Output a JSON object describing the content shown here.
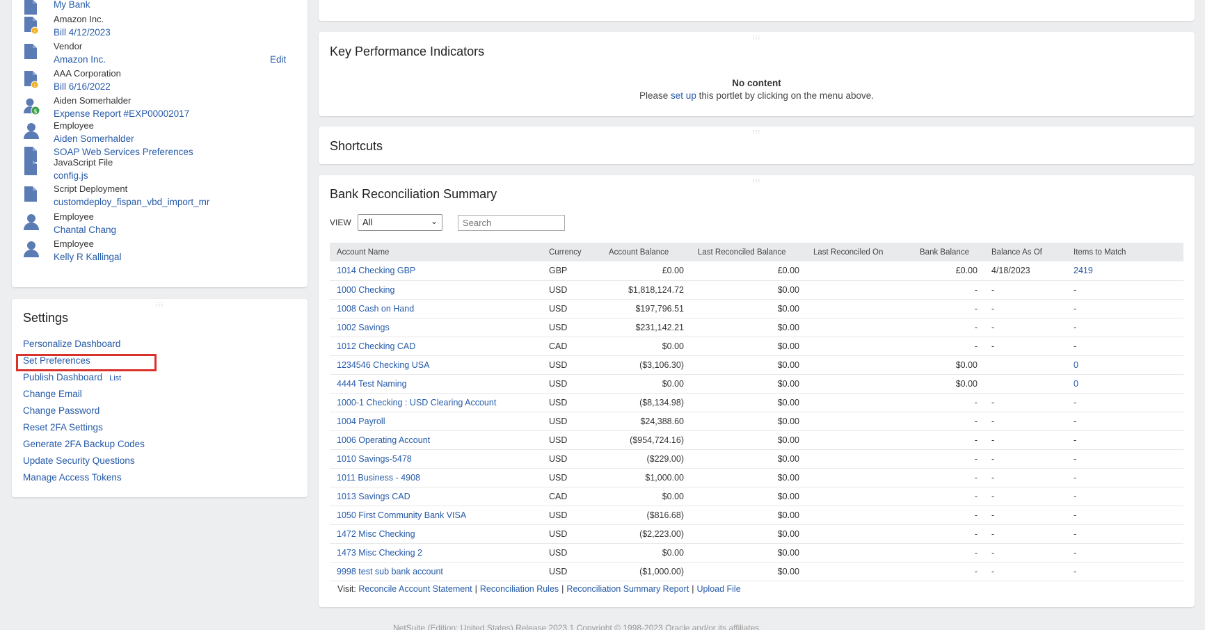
{
  "recent": {
    "items": [
      {
        "type": "",
        "name": "My Bank",
        "icon": "document-icon",
        "edit": ""
      },
      {
        "type": "Amazon Inc.",
        "name": "Bill 4/12/2023",
        "icon": "bill-document-icon",
        "edit": ""
      },
      {
        "type": "Vendor",
        "name": "Amazon Inc.",
        "icon": "document-icon",
        "edit": "Edit"
      },
      {
        "type": "AAA Corporation",
        "name": "Bill 6/16/2022",
        "icon": "bill-document-icon",
        "edit": ""
      },
      {
        "type": "Aiden Somerhalder",
        "name": "Expense Report #EXP00002017",
        "icon": "expense-report-icon",
        "edit": ""
      },
      {
        "type": "Employee",
        "name": "Aiden Somerhalder",
        "icon": "employee-icon",
        "edit": ""
      },
      {
        "type": "",
        "name": "SOAP Web Services Preferences",
        "icon": "document-icon",
        "edit": ""
      },
      {
        "type": "JavaScript File",
        "name": "config.js",
        "icon": "document-icon",
        "edit": ""
      },
      {
        "type": "Script Deployment",
        "name": "customdeploy_fispan_vbd_import_mr",
        "icon": "document-icon",
        "edit": ""
      },
      {
        "type": "Employee",
        "name": "Chantal Chang",
        "icon": "employee-icon",
        "edit": ""
      },
      {
        "type": "Employee",
        "name": "Kelly R Kallingal",
        "icon": "employee-icon",
        "edit": ""
      }
    ]
  },
  "settings": {
    "title": "Settings",
    "items": [
      {
        "label": "Personalize Dashboard",
        "sub": ""
      },
      {
        "label": "Set Preferences",
        "sub": ""
      },
      {
        "label": "Publish Dashboard",
        "sub": "List"
      },
      {
        "label": "Change Email",
        "sub": ""
      },
      {
        "label": "Change Password",
        "sub": ""
      },
      {
        "label": "Reset 2FA Settings",
        "sub": ""
      },
      {
        "label": "Generate 2FA Backup Codes",
        "sub": ""
      },
      {
        "label": "Update Security Questions",
        "sub": ""
      },
      {
        "label": "Manage Access Tokens",
        "sub": ""
      }
    ]
  },
  "kpi": {
    "title": "Key Performance Indicators",
    "no_content": "No content",
    "msg_pre": "Please",
    "msg_link": "set up",
    "msg_post": "this portlet by clicking on the menu above."
  },
  "shortcuts": {
    "title": "Shortcuts"
  },
  "bank": {
    "title": "Bank Reconciliation Summary",
    "view_label": "VIEW",
    "view_value": "All",
    "search_placeholder": "Search",
    "columns": [
      "Account Name",
      "Currency",
      "Account Balance",
      "Last Reconciled Balance",
      "Last Reconciled On",
      "Bank Balance",
      "Balance As Of",
      "Items to Match"
    ],
    "rows": [
      [
        "1014 Checking GBP",
        "GBP",
        "£0.00",
        "£0.00",
        "",
        "£0.00",
        "4/18/2023",
        "2419"
      ],
      [
        "1000 Checking",
        "USD",
        "$1,818,124.72",
        "$0.00",
        "",
        "-",
        "-",
        "-"
      ],
      [
        "1008 Cash on Hand",
        "USD",
        "$197,796.51",
        "$0.00",
        "",
        "-",
        "-",
        "-"
      ],
      [
        "1002 Savings",
        "USD",
        "$231,142.21",
        "$0.00",
        "",
        "-",
        "-",
        "-"
      ],
      [
        "1012 Checking CAD",
        "CAD",
        "$0.00",
        "$0.00",
        "",
        "-",
        "-",
        "-"
      ],
      [
        "1234546 Checking USA",
        "USD",
        "($3,106.30)",
        "$0.00",
        "",
        "$0.00",
        "",
        "0"
      ],
      [
        "4444 Test Naming",
        "USD",
        "$0.00",
        "$0.00",
        "",
        "$0.00",
        "",
        "0"
      ],
      [
        "1000-1 Checking : USD Clearing Account",
        "USD",
        "($8,134.98)",
        "$0.00",
        "",
        "-",
        "-",
        "-"
      ],
      [
        "1004 Payroll",
        "USD",
        "$24,388.60",
        "$0.00",
        "",
        "-",
        "-",
        "-"
      ],
      [
        "1006 Operating Account",
        "USD",
        "($954,724.16)",
        "$0.00",
        "",
        "-",
        "-",
        "-"
      ],
      [
        "1010 Savings-5478",
        "USD",
        "($229.00)",
        "$0.00",
        "",
        "-",
        "-",
        "-"
      ],
      [
        "1011 Business - 4908",
        "USD",
        "$1,000.00",
        "$0.00",
        "",
        "-",
        "-",
        "-"
      ],
      [
        "1013 Savings CAD",
        "CAD",
        "$0.00",
        "$0.00",
        "",
        "-",
        "-",
        "-"
      ],
      [
        "1050 First Community Bank VISA",
        "USD",
        "($816.68)",
        "$0.00",
        "",
        "-",
        "-",
        "-"
      ],
      [
        "1472 Misc Checking",
        "USD",
        "($2,223.00)",
        "$0.00",
        "",
        "-",
        "-",
        "-"
      ],
      [
        "1473 Misc Checking 2",
        "USD",
        "$0.00",
        "$0.00",
        "",
        "-",
        "-",
        "-"
      ],
      [
        "9998 test sub bank account",
        "USD",
        "($1,000.00)",
        "$0.00",
        "",
        "-",
        "-",
        "-"
      ]
    ],
    "visit_label": "Visit:",
    "visit_links": [
      "Reconcile Account Statement",
      "Reconciliation Rules",
      "Reconciliation Summary Report",
      "Upload File"
    ]
  },
  "footer": {
    "text": "NetSuite (Edition: United States) Release 2023.1 Copyright © 1998-2023 Oracle and/or its affiliates."
  },
  "colors": {
    "link": "#255aa8",
    "highlight": "#d9322b",
    "background": "#edeef0"
  }
}
